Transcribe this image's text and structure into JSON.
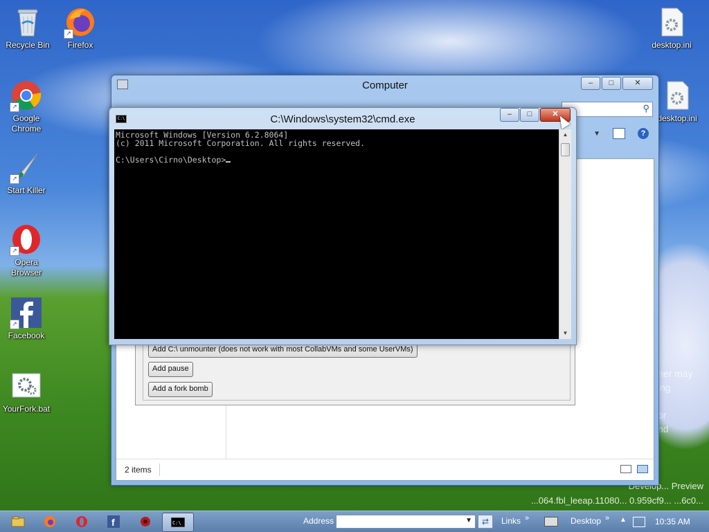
{
  "desktop": {
    "icons": [
      {
        "label": "Recycle Bin",
        "icon": "recycle-bin-icon"
      },
      {
        "label": "Firefox",
        "icon": "firefox-icon"
      },
      {
        "label": "Google Chrome",
        "icon": "chrome-icon"
      },
      {
        "label": "Start Killer",
        "icon": "knife-icon"
      },
      {
        "label": "Opera Browser",
        "icon": "opera-icon"
      },
      {
        "label": "Facebook",
        "icon": "facebook-icon"
      },
      {
        "label": "YourFork.bat",
        "icon": "batch-file-icon"
      },
      {
        "label": "desktop.ini",
        "icon": "settings-file-icon"
      },
      {
        "label": "desktop.ini",
        "icon": "settings-file-icon"
      }
    ],
    "watermark_line1": "Develop... Preview",
    "watermark_line2": "...064.fbl_leeap.11080... 0.959cf9... ...6c0...",
    "mascot_text_line1": "ner may",
    "mascot_text_line2": "ing",
    "mascot_text_line3": "or",
    "mascot_text_line4": "nd"
  },
  "explorer": {
    "title": "Computer",
    "status_items": "2 items",
    "dialog": {
      "buttons": [
        "Add C:\\ unmounter (does not work with most CollabVMs and some UserVMs)",
        "Add pause",
        "Add a fork bomb"
      ]
    }
  },
  "cmd": {
    "title": "C:\\Windows\\system32\\cmd.exe",
    "line1": "Microsoft Windows [Version 6.2.8064]",
    "line2": "(c) 2011 Microsoft Corporation. All rights reserved.",
    "prompt": "C:\\Users\\Cirno\\Desktop>"
  },
  "taskbar": {
    "address_label": "Address",
    "links_label": "Links",
    "desktop_label": "Desktop",
    "clock": "10:35 AM",
    "chevron": "»",
    "apps": [
      "explorer-icon",
      "firefox-icon",
      "opera-icon",
      "facebook-icon",
      "start-killer-icon",
      "cmd-icon"
    ]
  },
  "colors": {
    "console_bg": "#000000",
    "console_fg": "#c0c0c0",
    "close_button": "#c2361b"
  }
}
